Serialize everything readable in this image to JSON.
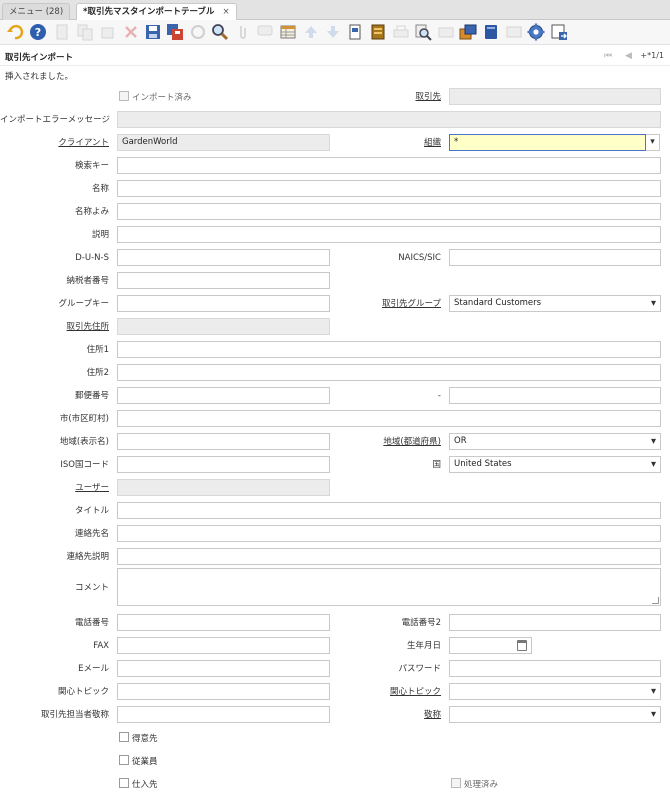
{
  "tabs": [
    {
      "label": "メニュー (28)"
    },
    {
      "label": "*取引先マスタインポートテーブル",
      "close": "×"
    }
  ],
  "toolbar": {
    "icons": [
      "undo-icon",
      "help-icon",
      "new-icon",
      "copy-icon",
      "delete-icon",
      "save-icon",
      "save-new-icon",
      "refresh-icon",
      "find-icon",
      "attachment-icon",
      "chat-icon",
      "grid-toggle-icon",
      "parent-record-icon",
      "detail-record-icon",
      "report-icon",
      "archive-icon",
      "print-icon",
      "zoom-across-icon",
      "workflow-icon",
      "product-info-icon",
      "request-icon",
      "settings-icon",
      "export-icon"
    ]
  },
  "window": {
    "title": "取引先インポート",
    "nav_first": "⏮",
    "nav_prev": "◀",
    "record": "+*1/1"
  },
  "status_message": "挿入されました。",
  "form": {
    "imported_label": "インポート済み",
    "bpartner_label": "取引先",
    "error_label": "インポートエラーメッセージ",
    "client_label": "クライアント",
    "client_value": "GardenWorld",
    "org_label": "組織",
    "org_value": "*",
    "search_key_label": "検索キー",
    "name_label": "名称",
    "name2_label": "名称よみ",
    "description_label": "説明",
    "duns_label": "D-U-N-S",
    "naics_label": "NAICS/SIC",
    "taxid_label": "納税者番号",
    "group_key_label": "グループキー",
    "bp_group_label": "取引先グループ",
    "bp_group_value": "Standard Customers",
    "bp_location_label": "取引先住所",
    "address1_label": "住所1",
    "address2_label": "住所2",
    "postal_label": "郵便番号",
    "postal_add_label": "-",
    "city_label": "市(市区町村)",
    "region_name_label": "地域(表示名)",
    "region_label": "地域(都道府県)",
    "region_value": "OR",
    "iso_label": "ISO国コード",
    "country_label": "国",
    "country_value": "United States",
    "user_label": "ユーザー",
    "title_label": "タイトル",
    "contact_name_label": "連絡先名",
    "contact_desc_label": "連絡先説明",
    "comment_label": "コメント",
    "phone_label": "電話番号",
    "phone2_label": "電話番号2",
    "fax_label": "FAX",
    "birthday_label": "生年月日",
    "email_label": "Eメール",
    "password_label": "パスワード",
    "interest_area_label": "関心トピック",
    "interest_area2_label": "関心トピック",
    "greeting_label": "取引先担当者敬称",
    "title2_label": "敬称",
    "customer_label": "得意先",
    "employee_label": "従業員",
    "vendor_label": "仕入先",
    "processed_label": "処理済み"
  },
  "colors": {
    "mandatory_bg": "#ffffc8",
    "focus_border": "#4a74c9",
    "readonly_bg": "#ececec"
  }
}
